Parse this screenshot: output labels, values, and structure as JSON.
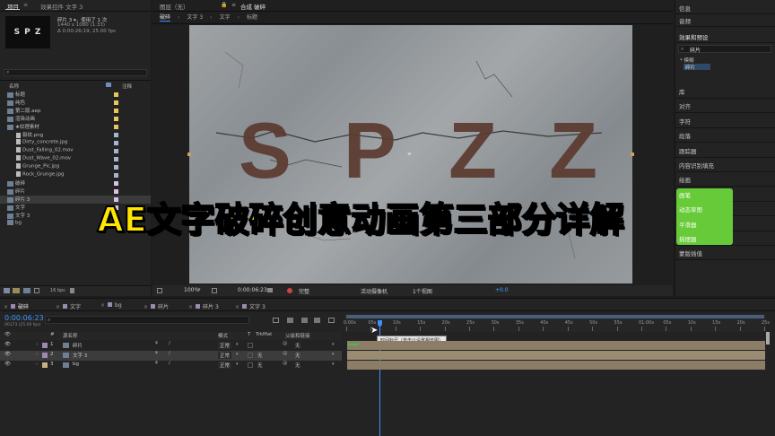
{
  "project_panel": {
    "tab_project": "项目",
    "tab_effects": "效果控件 文字 3",
    "thumb_text": "S P Z",
    "info_name": "碎片 3 ▾，使用了 1 次",
    "info_res": "1440 x 1080 (1.33)",
    "info_dur": "Δ 0:00:26:19, 25.00 fps",
    "col_name": "名称",
    "col_label": "注释",
    "items": [
      {
        "name": "标题",
        "color": "#e6c85a"
      },
      {
        "name": "纯色",
        "color": "#e6c85a"
      },
      {
        "name": "第二版.aep",
        "color": "#e6c85a"
      },
      {
        "name": "渲染动画",
        "color": "#e6c85a"
      },
      {
        "name": "★纹理素材",
        "color": "#e6c85a"
      },
      {
        "name": "裂纹.png",
        "color": "#a7b6cc"
      },
      {
        "name": "Dirty_concrete.jpg",
        "color": "#a7b6cc"
      },
      {
        "name": "Dust_Falling_02.mov",
        "color": "#a7b6cc"
      },
      {
        "name": "Dust_Wave_02.mov",
        "color": "#a7b6cc"
      },
      {
        "name": "Grunge_Pic.jpg",
        "color": "#a7b6cc"
      },
      {
        "name": "Rock_Grunge.jpg",
        "color": "#a7b6cc"
      },
      {
        "name": "破碎",
        "color": "#d8c2e2"
      },
      {
        "name": "碎片",
        "color": "#d8c2e2"
      },
      {
        "name": "碎片 3",
        "color": "#d8c2e2"
      },
      {
        "name": "文字",
        "color": "#d8c2e2"
      },
      {
        "name": "文字 3",
        "color": "#d8c2e2"
      },
      {
        "name": "bg",
        "color": "#d8c2e2"
      }
    ],
    "bpc": "16 bpc"
  },
  "comp_panel": {
    "tab_layer": "图层（无）",
    "tab_comp": "合成 破碎",
    "breadcrumbs": [
      "破碎",
      "文字 3",
      "文字",
      "标题"
    ],
    "letters": [
      "S",
      "P",
      "Z",
      "Z"
    ],
    "bottom": {
      "zoom": "100%",
      "time": "0:00:06:23",
      "quality": "完整",
      "camera": "活动摄像机",
      "views": "1个视图",
      "offset": "+0.0"
    }
  },
  "overlay_title": "AE文字破碎创意动画第三部分详解",
  "right_panel": {
    "items_top": [
      "信息",
      "音频",
      "效果和预设"
    ],
    "search": "碎片",
    "preset_group": "* 模糊",
    "preset_item": "碎片",
    "items": [
      "库",
      "对齐",
      "字符",
      "段落",
      "跟踪器",
      "内容识别填充",
      "绘画",
      "画笔",
      "动态草图",
      "平滑器",
      "摇摆器",
      "蒙版插值"
    ]
  },
  "timeline": {
    "tabs": [
      "破碎",
      "文字",
      "bg",
      "碎片",
      "碎片 3",
      "文字 3"
    ],
    "timecode": "0:00:06:23",
    "fps_note": "00173 (25.00 fps)",
    "cols": {
      "num": "#",
      "source": "源名称",
      "mode": "模式",
      "t": "T",
      "trkmat": "TrkMat",
      "parent": "父级和链接"
    },
    "layers": [
      {
        "num": "1",
        "name": "碎片",
        "mode": "正常",
        "trk": "",
        "parent": "无"
      },
      {
        "num": "2",
        "name": "文字 3",
        "mode": "正常",
        "trk": "无",
        "parent": "无"
      },
      {
        "num": "3",
        "name": "bg",
        "mode": "正常",
        "trk": "无",
        "parent": "无"
      }
    ],
    "ruler": [
      "0:00s",
      "05s",
      "10s",
      "15s",
      "20s",
      "25s",
      "30s",
      "35s",
      "40s",
      "45s",
      "50s",
      "55s",
      "01:00s",
      "05s",
      "10s",
      "15s",
      "20s",
      "25s"
    ],
    "tooltip": "时间标尺（单击以设置相览图）"
  }
}
